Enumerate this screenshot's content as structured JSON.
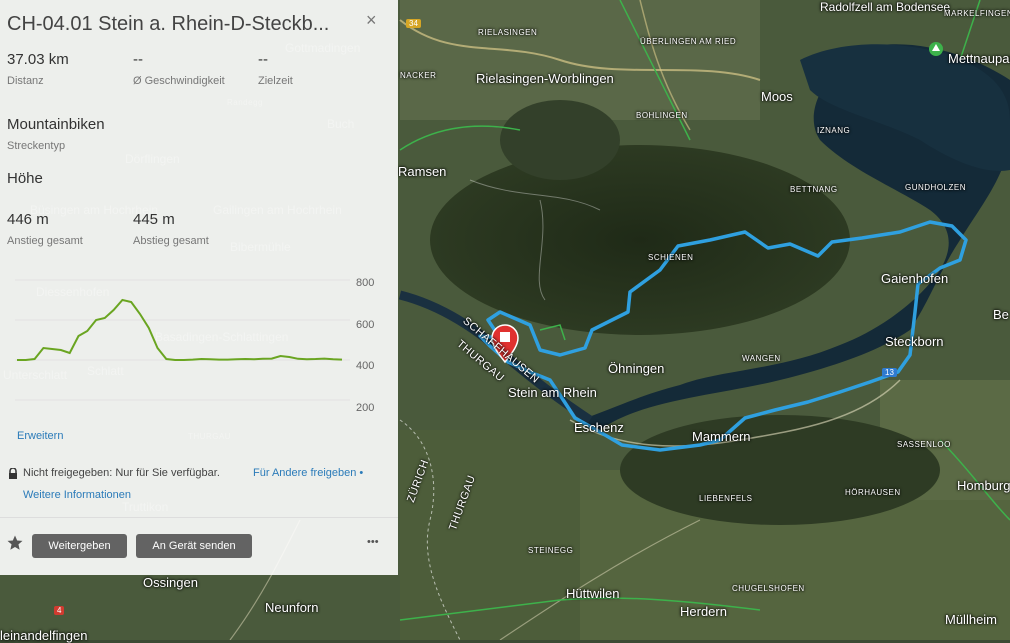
{
  "panel": {
    "title": "CH-04.01 Stein a. Rhein-D-Steckb...",
    "close": "×",
    "stats": [
      {
        "value": "37.03 km",
        "label": "Distanz"
      },
      {
        "value": "--",
        "label": "Ø Geschwindigkeit"
      },
      {
        "value": "--",
        "label": "Zielzeit"
      }
    ],
    "route_type": {
      "value": "Mountainbiken",
      "label": "Streckentyp"
    },
    "elevation_heading": "Höhe",
    "ascent": {
      "value": "446 m",
      "label": "Anstieg gesamt"
    },
    "descent": {
      "value": "445 m",
      "label": "Abstieg gesamt"
    },
    "expand_link": "Erweitern",
    "privacy_text": "Nicht freigegeben: Nur für Sie verfügbar.",
    "share_link": "Für Andere freigeben •",
    "more_info_link": "Weitere Informationen",
    "share_button": "Weitergeben",
    "send_button": "An Gerät senden",
    "more_menu": "•••",
    "accent_color": "#2b7bb9",
    "profile_color": "#6aa521"
  },
  "chart_data": {
    "type": "area",
    "y_ticks": [
      "800",
      "600",
      "400",
      "200"
    ],
    "ylim": [
      100,
      850
    ],
    "x": [
      0,
      1,
      2,
      3,
      4,
      5,
      6,
      7,
      8,
      9,
      10,
      11,
      12,
      13,
      14,
      15,
      16,
      17,
      18,
      19,
      20,
      21,
      22,
      23,
      24,
      25,
      26,
      27,
      28,
      29,
      30,
      31,
      32,
      33,
      34,
      35,
      36,
      37
    ],
    "values": [
      400,
      400,
      405,
      460,
      455,
      450,
      435,
      520,
      545,
      600,
      610,
      650,
      700,
      690,
      630,
      560,
      460,
      405,
      400,
      400,
      402,
      405,
      404,
      402,
      402,
      404,
      405,
      404,
      406,
      407,
      420,
      415,
      406,
      404,
      405,
      407,
      404,
      402
    ]
  },
  "map": {
    "places": [
      {
        "name": "Rielasingen-Worblingen"
      },
      {
        "name": "Moos"
      },
      {
        "name": "Ramsen"
      },
      {
        "name": "Gaienhofen"
      },
      {
        "name": "Steckborn"
      },
      {
        "name": "Öhningen"
      },
      {
        "name": "Stein am Rhein"
      },
      {
        "name": "Eschenz"
      },
      {
        "name": "Mammern"
      },
      {
        "name": "Homburg"
      },
      {
        "name": "Hüttwilen"
      },
      {
        "name": "Herdern"
      },
      {
        "name": "Müllheim"
      },
      {
        "name": "Ossingen"
      },
      {
        "name": "Neunforn"
      },
      {
        "name": "Mettnaupark"
      },
      {
        "name": "Radolfzell am Bodensee"
      }
    ],
    "small_labels": [
      "RIELASINGEN",
      "ÜBERLINGEN AM RIED",
      "BOHLINGEN",
      "IZNANG",
      "BETTNANG",
      "GUNDHOLZEN",
      "SCHIENEN",
      "WANGEN",
      "SASSENLOO",
      "HÖRHAUSEN",
      "LIEBENFELS",
      "STEINEGG",
      "CHUGELSHOFEN",
      "MARKELFINGEN",
      "SCHAFFHAUSEN",
      "THURGAU",
      "ZÜRICH",
      "NACKER"
    ],
    "edge_labels": [
      "Be",
      "leinandelfingen"
    ],
    "faint_labels": [
      "Gottmadingen",
      "Buch",
      "Dörflingen",
      "Büsingen am Hochrhein",
      "Gailingen am Hochrhein",
      "Randegg",
      "Bibermühle",
      "Diessenhofen",
      "Basadingen-Schlattingen",
      "Schlatt",
      "Truttikon",
      "Unterschlatt",
      "THURGAU"
    ],
    "shields": [
      "34",
      "13",
      "4"
    ]
  }
}
